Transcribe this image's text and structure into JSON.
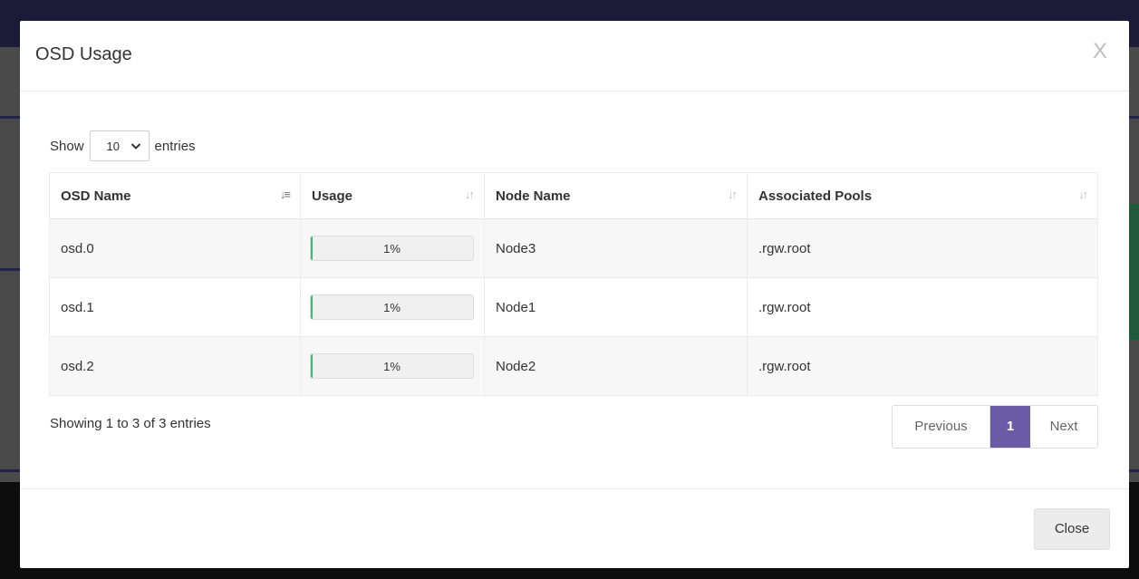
{
  "modal": {
    "title": "OSD Usage",
    "close_x": "X",
    "close_button": "Close"
  },
  "length": {
    "show_label": "Show",
    "selected": "10",
    "entries_label": "entries"
  },
  "table": {
    "columns": [
      "OSD Name",
      "Usage",
      "Node Name",
      "Associated Pools"
    ],
    "rows": [
      {
        "osd": "osd.0",
        "usage_pct": 1,
        "usage_label": "1%",
        "node": "Node3",
        "pools": ".rgw.root"
      },
      {
        "osd": "osd.1",
        "usage_pct": 1,
        "usage_label": "1%",
        "node": "Node1",
        "pools": ".rgw.root"
      },
      {
        "osd": "osd.2",
        "usage_pct": 1,
        "usage_label": "1%",
        "node": "Node2",
        "pools": ".rgw.root"
      }
    ]
  },
  "info": "Showing 1 to 3 of 3 entries",
  "pagination": {
    "previous": "Previous",
    "current": "1",
    "next": "Next"
  },
  "colors": {
    "accent": "#6b5ba7",
    "usage_bar": "#3cb878"
  },
  "icons": {
    "sort_active": "sort-alpha-asc-icon",
    "sort_inactive": "sort-icon",
    "dropdown": "chevron-down-icon"
  }
}
